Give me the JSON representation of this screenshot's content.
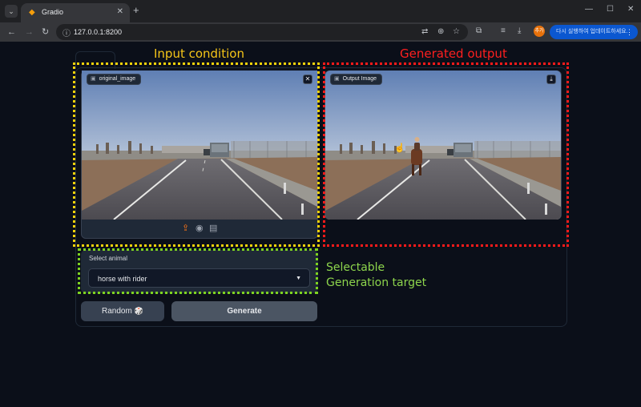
{
  "browser": {
    "tab_title": "Gradio",
    "url": "127.0.0.1:8200",
    "profile_initial": "추가",
    "update_label": "다시 실행하여 업데이트하세요."
  },
  "annotations": {
    "input_heading": "Input condition",
    "output_heading": "Generated output",
    "select_heading_line1": "Selectable",
    "select_heading_line2": "Generation target"
  },
  "input_image": {
    "label": "original_image",
    "sources": [
      "upload-icon",
      "webcam-icon",
      "clipboard-icon"
    ]
  },
  "output_image": {
    "label": "Output Image"
  },
  "animal_select": {
    "label": "Select animal",
    "value": "horse with rider"
  },
  "buttons": {
    "random_label": "Random",
    "random_emoji": "🎲",
    "generate_label": "Generate"
  },
  "colors": {
    "input_highlight": "#f5d20a",
    "output_highlight": "#ff1a1a",
    "select_highlight": "#7ed321",
    "page_bg": "#0b0f19"
  }
}
